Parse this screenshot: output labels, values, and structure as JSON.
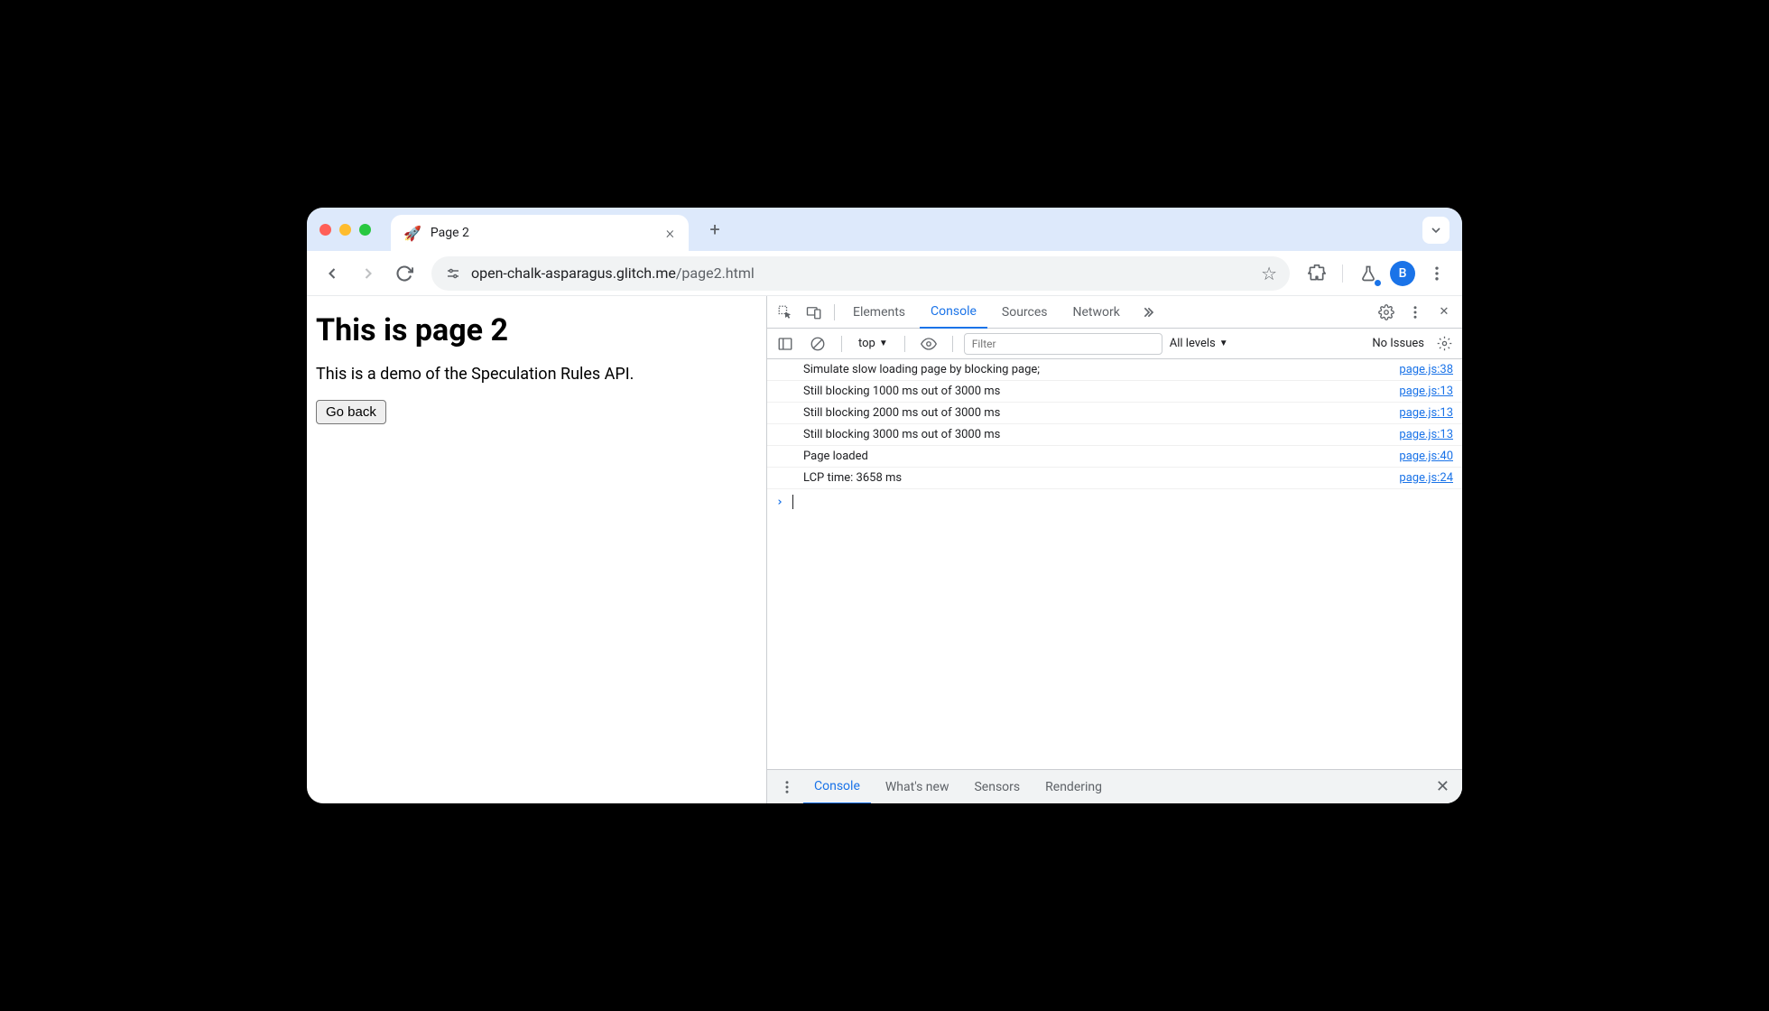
{
  "tab": {
    "favicon": "🚀",
    "title": "Page 2"
  },
  "url": {
    "host": "open-chalk-asparagus.glitch.me",
    "path": "/page2.html"
  },
  "avatar_letter": "B",
  "page": {
    "heading": "This is page 2",
    "text": "This is a demo of the Speculation Rules API.",
    "button": "Go back"
  },
  "devtools": {
    "tabs": [
      "Elements",
      "Console",
      "Sources",
      "Network"
    ],
    "active_tab": "Console",
    "context": "top",
    "filter_placeholder": "Filter",
    "levels": "All levels",
    "issues": "No Issues",
    "logs": [
      {
        "msg": "Simulate slow loading page by blocking page;",
        "src": "page.js:38"
      },
      {
        "msg": "Still blocking 1000 ms out of 3000 ms",
        "src": "page.js:13"
      },
      {
        "msg": "Still blocking 2000 ms out of 3000 ms",
        "src": "page.js:13"
      },
      {
        "msg": "Still blocking 3000 ms out of 3000 ms",
        "src": "page.js:13"
      },
      {
        "msg": "Page loaded",
        "src": "page.js:40"
      },
      {
        "msg": "LCP time: 3658 ms",
        "src": "page.js:24"
      }
    ],
    "drawer_tabs": [
      "Console",
      "What's new",
      "Sensors",
      "Rendering"
    ],
    "drawer_active": "Console"
  }
}
